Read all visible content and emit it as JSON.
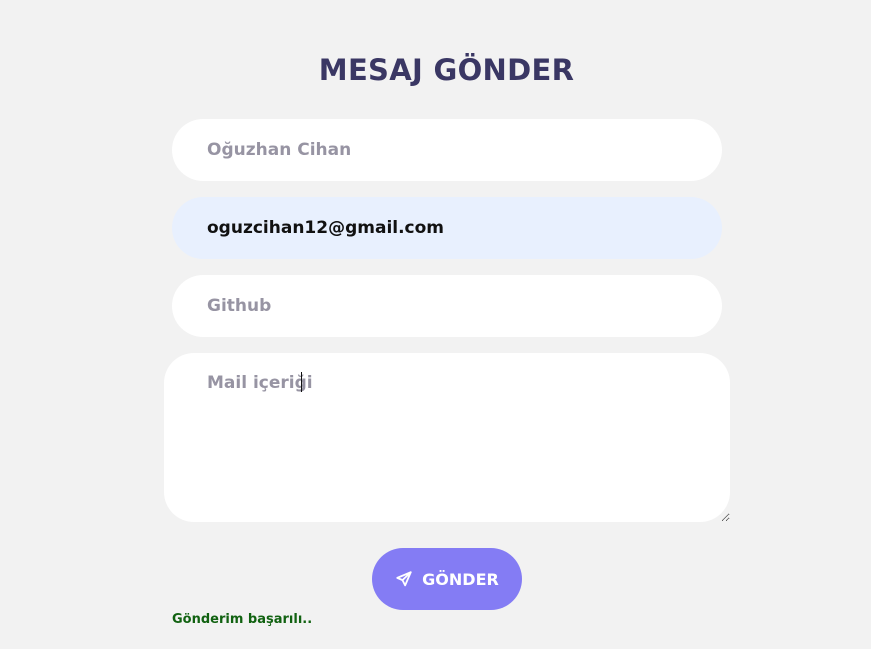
{
  "form": {
    "title": "MESAJ GÖNDER",
    "name_placeholder": "Oğuzhan Cihan",
    "name_value": "",
    "email_placeholder": "",
    "email_value": "oguzcihan12@gmail.com",
    "github_placeholder": "Github",
    "github_value": "",
    "message_placeholder": "Mail içeriği",
    "message_value": "",
    "send_label": "GÖNDER",
    "send_icon": "paper-plane-icon",
    "status_text": "Gönderim başarılı..",
    "colors": {
      "background": "#f2f2f2",
      "title": "#3a3764",
      "accent": "#847cf4",
      "autofill": "#e8f0fe",
      "placeholder": "#9794a3",
      "success": "#116211"
    }
  }
}
